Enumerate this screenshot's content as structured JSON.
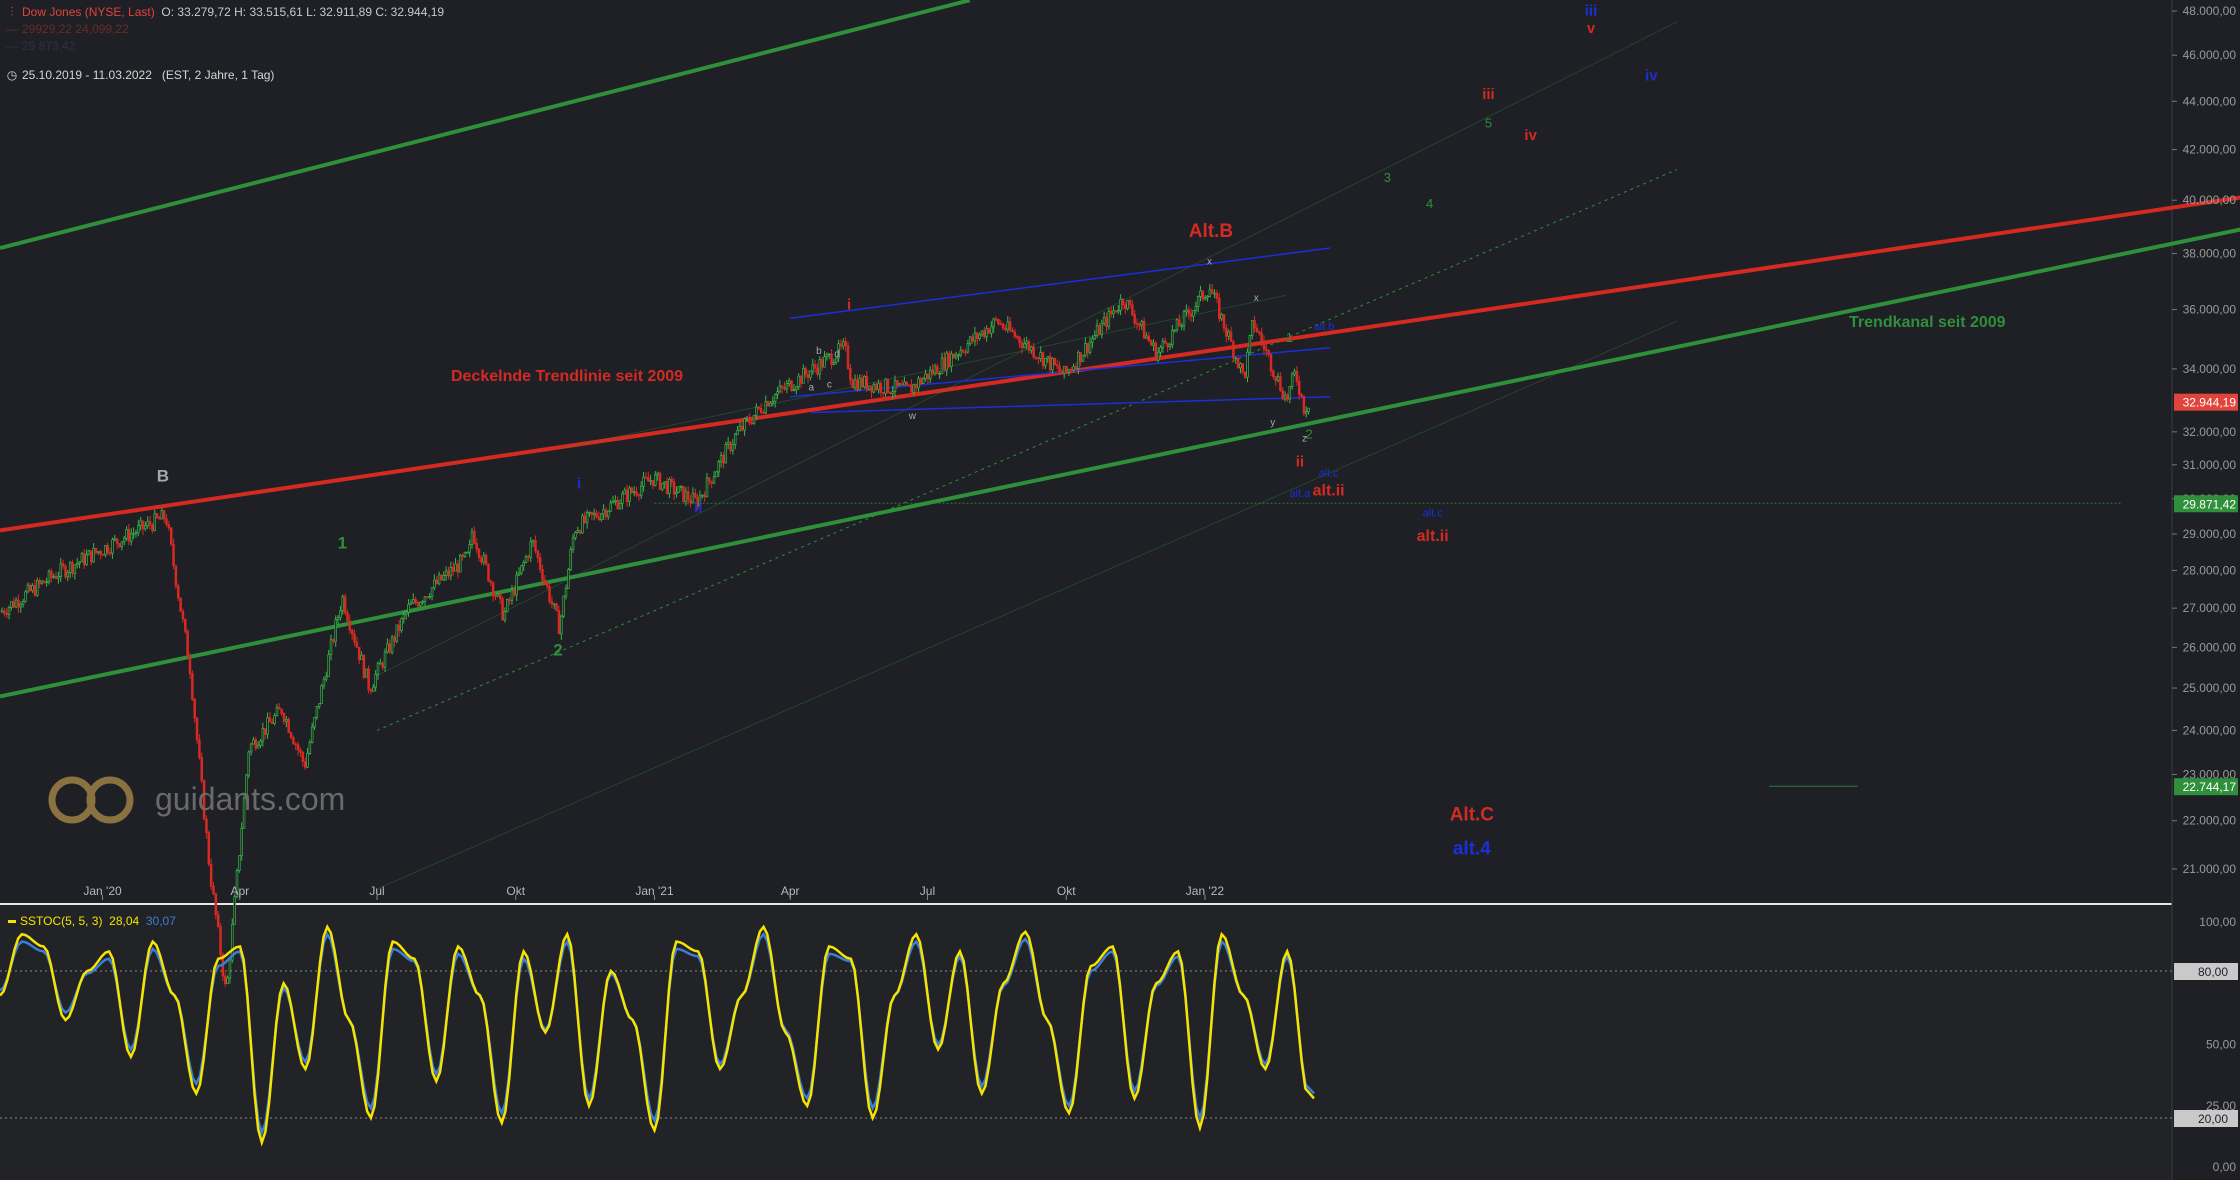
{
  "header": {
    "instrument": "Dow Jones (NYSE, Last)",
    "ohlc": "O: 33.279,72  H: 33.515,61  L: 32.911,89  C: 32.944,19",
    "faded_line_1": "29929,22 24,099,22",
    "faded_line_2": "29 873,42",
    "period": "25.10.2019 - 11.03.2022",
    "period_info": "(EST, 2 Jahre, 1 Tag)"
  },
  "oscillator_legend": {
    "name": "SSTOC(5, 5, 3)",
    "value_k": "28,04",
    "value_d": "30,07"
  },
  "colors": {
    "background": "#1e2025",
    "green_line": "#2f8f3a",
    "red_line": "#d42a22",
    "blue_line": "#1c2fd6",
    "stoch_k": "#f5e400",
    "stoch_d": "#3b7dd8",
    "price_badge_red": "#e0443a",
    "price_badge_green": "#2f8f3a"
  },
  "watermark": {
    "text": "guidants.com",
    "icon": "guidants-logo-icon"
  },
  "chart_data": [
    {
      "type": "line",
      "subtype": "candlestick",
      "series": [
        {
          "name": "Dow Jones (NYSE, Last)",
          "dates": [
            "2019-10-25",
            "2019-12-01",
            "2020-01-15",
            "2020-02-12",
            "2020-02-28",
            "2020-03-12",
            "2020-03-23",
            "2020-04-07",
            "2020-04-29",
            "2020-05-14",
            "2020-06-08",
            "2020-06-26",
            "2020-07-22",
            "2020-08-31",
            "2020-09-02",
            "2020-09-23",
            "2020-10-12",
            "2020-10-30",
            "2020-11-09",
            "2020-12-31",
            "2021-01-29",
            "2021-02-24",
            "2021-03-17",
            "2021-05-07",
            "2021-05-12",
            "2021-06-18",
            "2021-08-16",
            "2021-09-30",
            "2021-11-08",
            "2021-11-30",
            "2022-01-04",
            "2022-01-27",
            "2022-02-02",
            "2022-02-24",
            "2022-03-02",
            "2022-03-08",
            "2022-03-11"
          ],
          "values": [
            26900,
            27900,
            28900,
            29500,
            25500,
            21000,
            18600,
            23600,
            24500,
            23200,
            27300,
            25000,
            27000,
            28400,
            29100,
            26800,
            28800,
            26500,
            29150,
            30600,
            29900,
            31900,
            33000,
            34700,
            33600,
            33300,
            35600,
            33800,
            36400,
            34500,
            36800,
            33700,
            35600,
            33000,
            33900,
            32700,
            32944
          ]
        }
      ],
      "x_ticks": [
        "Jan '20",
        "Apr",
        "Jul",
        "Okt",
        "Jan '21",
        "Apr",
        "Jul",
        "Okt",
        "Jan '22"
      ],
      "y_ticks": [
        "48.000,00",
        "46.000,00",
        "44.000,00",
        "42.000,00",
        "40.000,00",
        "38.000,00",
        "36.000,00",
        "34.000,00",
        "32.000,00",
        "31.000,00",
        "30.000,00",
        "29.000,00",
        "28.000,00",
        "27.000,00",
        "26.000,00",
        "25.000,00",
        "24.000,00",
        "23.000,00",
        "22.000,00",
        "21.000,00"
      ],
      "y_scale": "log",
      "ylim": [
        20300,
        48500
      ],
      "grid": false,
      "price_badges": [
        {
          "label": "32.944,19",
          "value": 32944.19,
          "color": "red"
        },
        {
          "label": "29.871,42",
          "value": 29871.42,
          "color": "green"
        },
        {
          "label": "22.744,17",
          "value": 22744.17,
          "color": "green"
        }
      ],
      "horizontal_lines": [
        {
          "from": "2021-01-01",
          "to": "2023-09-01",
          "value": 29871.42,
          "color": "green",
          "style": "dashed"
        },
        {
          "from": "2023-01-10",
          "to": "2023-03-10",
          "value": 22744.17,
          "color": "green",
          "style": "thin"
        }
      ],
      "trendlines": [
        {
          "name": "Deckelnde Trendlinie seit 2009",
          "color": "red",
          "from": [
            "2019-10-25",
            29100
          ],
          "to": [
            "2024-04-25",
            41500
          ]
        },
        {
          "name": "Trendkanal seit 2009",
          "color": "green",
          "from": [
            "2019-10-25",
            24800
          ],
          "to": [
            "2024-04-25",
            40800
          ]
        },
        {
          "name": "",
          "color": "green",
          "from": [
            "2019-10-25",
            38200
          ],
          "to": [
            "2021-07-29",
            48500
          ]
        }
      ],
      "annotations": [
        {
          "text": "B",
          "color": "gray",
          "x": "2020-02-10",
          "y": 30500
        },
        {
          "text": "1",
          "color": "green",
          "x": "2020-06-08",
          "y": 28600
        },
        {
          "text": "2",
          "color": "green",
          "x": "2020-10-29",
          "y": 25800
        },
        {
          "text": "i",
          "color": "blue",
          "x": "2020-11-12",
          "y": 30300
        },
        {
          "text": "ii",
          "color": "blue",
          "x": "2021-01-30",
          "y": 29600
        },
        {
          "text": "i",
          "color": "red",
          "x": "2021-05-10",
          "y": 36000
        },
        {
          "text": "a",
          "color": "gray",
          "x": "2021-04-15",
          "y": 33300
        },
        {
          "text": "b",
          "color": "gray",
          "x": "2021-04-20",
          "y": 34500
        },
        {
          "text": "c",
          "color": "gray",
          "x": "2021-04-27",
          "y": 33400
        },
        {
          "text": "d",
          "color": "gray",
          "x": "2021-05-02",
          "y": 34400
        },
        {
          "text": "w",
          "color": "gray",
          "x": "2021-06-21",
          "y": 32400
        },
        {
          "text": "x",
          "color": "gray",
          "x": "2022-01-04",
          "y": 37600
        },
        {
          "text": "x",
          "color": "gray",
          "x": "2022-02-04",
          "y": 36300
        },
        {
          "text": "y",
          "color": "gray",
          "x": "2022-02-15",
          "y": 32200
        },
        {
          "text": "z",
          "color": "gray",
          "x": "2022-03-08",
          "y": 31700
        },
        {
          "text": "Alt.B",
          "color": "red",
          "x": "2022-01-05",
          "y": 38600
        },
        {
          "text": "1",
          "color": "green",
          "x": "2022-02-26",
          "y": 34900
        },
        {
          "text": "2",
          "color": "green",
          "x": "2022-03-11",
          "y": 31800
        },
        {
          "text": "ii",
          "color": "red",
          "x": "2022-03-05",
          "y": 30950
        },
        {
          "text": "alt.a",
          "color": "blue",
          "x": "2022-03-05",
          "y": 30050
        },
        {
          "text": "alt.b",
          "color": "blue",
          "x": "2022-03-21",
          "y": 35300
        },
        {
          "text": "alt.c",
          "color": "blue",
          "x": "2022-03-24",
          "y": 30650
        },
        {
          "text": "alt.ii",
          "color": "red",
          "x": "2022-03-24",
          "y": 30100
        },
        {
          "text": "alt.c",
          "color": "blue",
          "x": "2022-06-01",
          "y": 29500
        },
        {
          "text": "alt.ii",
          "color": "red",
          "x": "2022-06-01",
          "y": 28800
        },
        {
          "text": "3",
          "color": "green",
          "x": "2022-05-02",
          "y": 40700
        },
        {
          "text": "4",
          "color": "green",
          "x": "2022-05-30",
          "y": 39700
        },
        {
          "text": "5",
          "color": "green",
          "x": "2022-07-08",
          "y": 42900
        },
        {
          "text": "iii",
          "color": "red",
          "x": "2022-07-08",
          "y": 44100
        },
        {
          "text": "iv",
          "color": "red",
          "x": "2022-08-05",
          "y": 42400
        },
        {
          "text": "iii",
          "color": "blue",
          "x": "2022-09-14",
          "y": 47800
        },
        {
          "text": "v",
          "color": "red",
          "x": "2022-09-14",
          "y": 47000
        },
        {
          "text": "iv",
          "color": "blue",
          "x": "2022-10-24",
          "y": 44900
        },
        {
          "text": "Alt.C",
          "color": "red",
          "x": "2022-06-27",
          "y": 22000
        },
        {
          "text": "alt.4",
          "color": "blue",
          "x": "2022-06-27",
          "y": 21300
        }
      ]
    },
    {
      "type": "line",
      "title": "SSTOC(5, 5, 3)",
      "ylim": [
        0,
        100
      ],
      "y_ticks": [
        "100,00",
        "80,00",
        "50,00",
        "25,00",
        "20,00",
        "0,00"
      ],
      "levels": [
        80,
        20
      ],
      "series": [
        {
          "name": "SSTOC(5, 5, 3)",
          "color": "yellow",
          "values": [
            70,
            95,
            90,
            60,
            80,
            88,
            45,
            92,
            70,
            30,
            85,
            90,
            10,
            75,
            40,
            98,
            60,
            20,
            92,
            85,
            35,
            90,
            70,
            18,
            88,
            55,
            95,
            25,
            80,
            60,
            15,
            92,
            88,
            40,
            70,
            98,
            55,
            25,
            90,
            85,
            20,
            70,
            95,
            48,
            88,
            30,
            75,
            96,
            60,
            22,
            82,
            90,
            28,
            75,
            88,
            16,
            95,
            70,
            40,
            88,
            28
          ]
        },
        {
          "name": "",
          "color": "blue",
          "values": [
            72,
            92,
            88,
            63,
            79,
            85,
            48,
            89,
            70,
            34,
            82,
            88,
            14,
            73,
            43,
            95,
            60,
            24,
            89,
            84,
            38,
            87,
            70,
            22,
            85,
            56,
            92,
            28,
            79,
            60,
            19,
            89,
            86,
            42,
            70,
            95,
            56,
            28,
            87,
            84,
            24,
            70,
            92,
            50,
            86,
            33,
            74,
            93,
            60,
            25,
            80,
            88,
            31,
            74,
            86,
            20,
            92,
            70,
            42,
            86,
            30
          ]
        }
      ]
    }
  ],
  "ui": {
    "y_ticks_main": [
      "48.000,00",
      "46.000,00",
      "44.000,00",
      "42.000,00",
      "40.000,00",
      "38.000,00",
      "36.000,00",
      "34.000,00",
      "32.000,00",
      "31.000,00",
      "30.000,00",
      "29.000,00",
      "28.000,00",
      "27.000,00",
      "26.000,00",
      "25.000,00",
      "24.000,00",
      "23.000,00",
      "22.000,00",
      "21.000,00"
    ]
  }
}
